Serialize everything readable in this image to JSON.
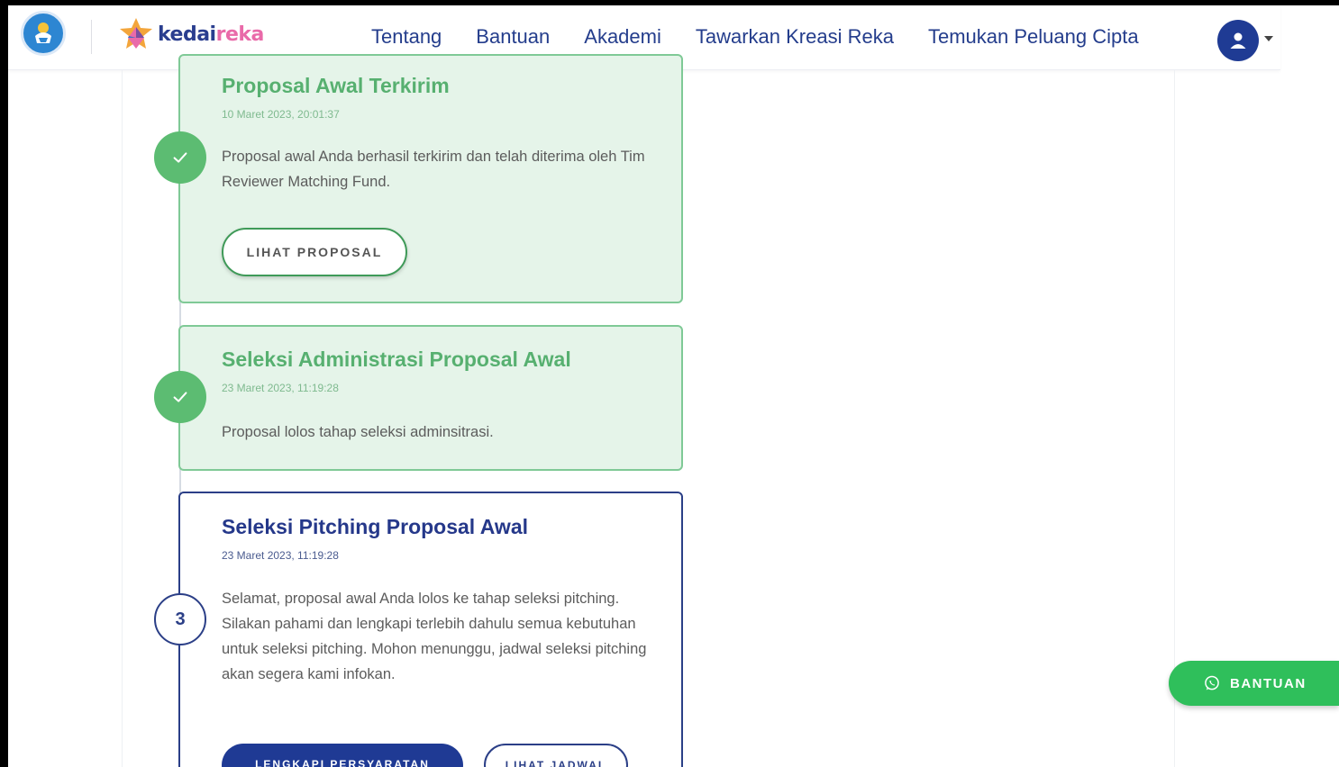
{
  "header": {
    "brand": {
      "part1": "kedai",
      "part2": "reka"
    },
    "nav": [
      "Tentang",
      "Bantuan",
      "Akademi",
      "Tawarkan Kreasi Reka",
      "Temukan Peluang Cipta"
    ]
  },
  "timeline": [
    {
      "title": "Proposal Awal Terkirim",
      "date": "10 Maret 2023, 20:01:37",
      "desc": "Proposal awal Anda berhasil terkirim dan telah diterima oleh Tim Reviewer Matching Fund.",
      "button": "LIHAT PROPOSAL",
      "status": "done"
    },
    {
      "title": "Seleksi Administrasi Proposal Awal",
      "date": "23 Maret 2023, 11:19:28",
      "desc": "Proposal lolos tahap seleksi adminsitrasi.",
      "status": "done"
    },
    {
      "step_number": "3",
      "title": "Seleksi Pitching Proposal Awal",
      "date": "23 Maret 2023, 11:19:28",
      "desc": "Selamat, proposal awal Anda lolos ke tahap seleksi pitching. Silakan pahami dan lengkapi terlebih dahulu semua kebutuhan untuk seleksi pitching. Mohon menunggu, jadwal seleksi pitching akan segera kami infokan.",
      "buttons": [
        "LENGKAPI PERSYARATAN",
        "LIHAT JADWAL"
      ],
      "status": "active"
    }
  ],
  "floating_help": {
    "label": "BANTUAN",
    "icon": "whatsapp-icon"
  },
  "colors": {
    "primary": "#1f3a94",
    "success": "#5cbc72",
    "success_bg": "#e5f4e9",
    "help": "#2fbf5b"
  }
}
